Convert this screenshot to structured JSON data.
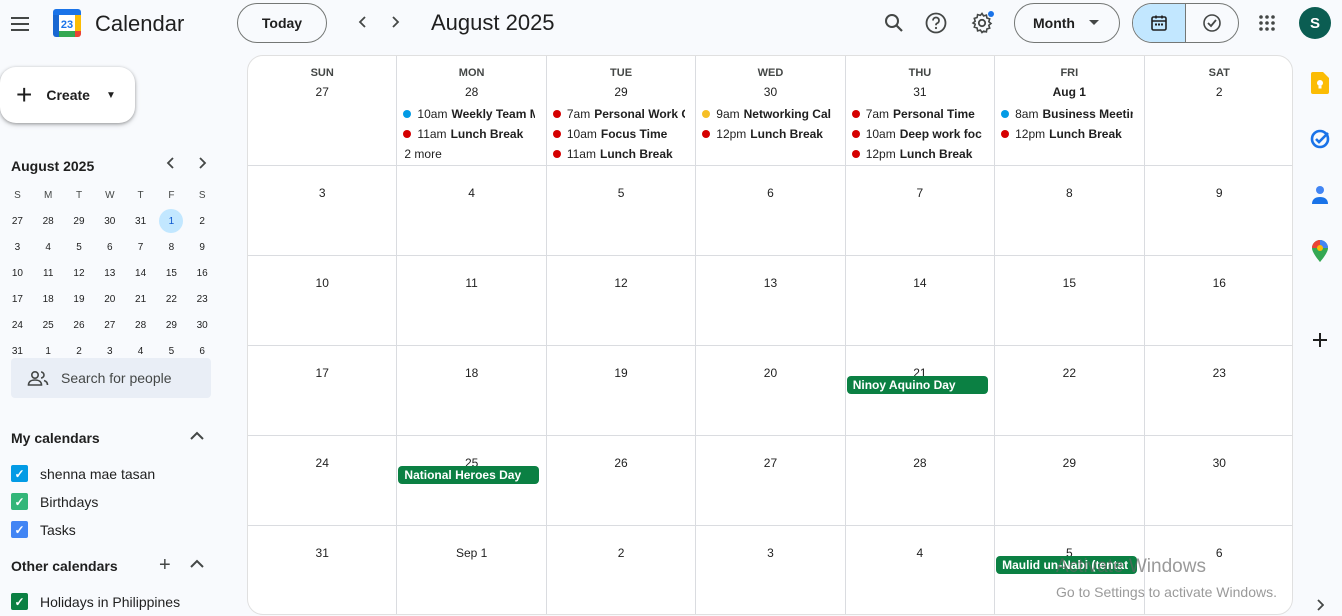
{
  "header": {
    "app_title": "Calendar",
    "logo_day": "23",
    "today_label": "Today",
    "month_title": "August 2025",
    "view_label": "Month",
    "avatar_initial": "S"
  },
  "create": {
    "label": "Create"
  },
  "mini_calendar": {
    "title": "August 2025",
    "weekdays": [
      "S",
      "M",
      "T",
      "W",
      "T",
      "F",
      "S"
    ],
    "weeks": [
      [
        "27",
        "28",
        "29",
        "30",
        "31",
        "1",
        "2"
      ],
      [
        "3",
        "4",
        "5",
        "6",
        "7",
        "8",
        "9"
      ],
      [
        "10",
        "11",
        "12",
        "13",
        "14",
        "15",
        "16"
      ],
      [
        "17",
        "18",
        "19",
        "20",
        "21",
        "22",
        "23"
      ],
      [
        "24",
        "25",
        "26",
        "27",
        "28",
        "29",
        "30"
      ],
      [
        "31",
        "1",
        "2",
        "3",
        "4",
        "5",
        "6"
      ]
    ],
    "selected": "1"
  },
  "search_people": {
    "placeholder": "Search for people"
  },
  "my_calendars": {
    "title": "My calendars",
    "items": [
      {
        "label": "shenna mae tasan",
        "color": "#039be5"
      },
      {
        "label": "Birthdays",
        "color": "#33b679"
      },
      {
        "label": "Tasks",
        "color": "#4285f4"
      }
    ]
  },
  "other_calendars": {
    "title": "Other calendars",
    "items": [
      {
        "label": "Holidays in Philippines",
        "color": "#0b8043"
      }
    ]
  },
  "grid": {
    "weekdays": [
      "SUN",
      "MON",
      "TUE",
      "WED",
      "THU",
      "FRI",
      "SAT"
    ],
    "weeks": [
      {
        "days": [
          "27",
          "28",
          "29",
          "30",
          "31",
          "Aug 1",
          "2"
        ],
        "events": [
          [],
          [
            {
              "time": "10am",
              "title": "Weekly Team M",
              "color": "#039be5"
            },
            {
              "time": "11am",
              "title": "Lunch Break",
              "color": "#d50000"
            }
          ],
          [
            {
              "time": "7am",
              "title": "Personal Work C",
              "color": "#d50000"
            },
            {
              "time": "10am",
              "title": "Focus Time",
              "color": "#d50000"
            },
            {
              "time": "11am",
              "title": "Lunch Break",
              "color": "#d50000"
            }
          ],
          [
            {
              "time": "9am",
              "title": "Networking Cal",
              "color": "#f6bf26"
            },
            {
              "time": "12pm",
              "title": "Lunch Break",
              "color": "#d50000"
            }
          ],
          [
            {
              "time": "7am",
              "title": "Personal Time",
              "color": "#d50000"
            },
            {
              "time": "10am",
              "title": "Deep work foc",
              "color": "#d50000"
            },
            {
              "time": "12pm",
              "title": "Lunch Break",
              "color": "#d50000"
            }
          ],
          [
            {
              "time": "8am",
              "title": "Business Meetin",
              "color": "#039be5"
            },
            {
              "time": "12pm",
              "title": "Lunch Break",
              "color": "#d50000"
            }
          ],
          []
        ],
        "more": [
          "",
          "2 more",
          "",
          "",
          "",
          "",
          ""
        ]
      },
      {
        "days": [
          "3",
          "4",
          "5",
          "6",
          "7",
          "8",
          "9"
        ]
      },
      {
        "days": [
          "10",
          "11",
          "12",
          "13",
          "14",
          "15",
          "16"
        ]
      },
      {
        "days": [
          "17",
          "18",
          "19",
          "20",
          "21",
          "22",
          "23"
        ],
        "allday": [
          [
            "",
            "",
            "",
            "",
            "Ninoy Aquino Day",
            "",
            ""
          ]
        ]
      },
      {
        "days": [
          "24",
          "25",
          "26",
          "27",
          "28",
          "29",
          "30"
        ],
        "allday": [
          [
            "",
            "National Heroes Day",
            "",
            "",
            "",
            "",
            ""
          ]
        ]
      },
      {
        "days": [
          "31",
          "Sep 1",
          "2",
          "3",
          "4",
          "5",
          "6"
        ],
        "allday": [
          [
            "",
            "",
            "",
            "",
            "",
            "Maulid un-Nabi (tentat",
            ""
          ]
        ]
      }
    ]
  },
  "watermark": {
    "line1": "Activate Windows",
    "line2": "Go to Settings to activate Windows."
  },
  "icons": {
    "search": "search-icon",
    "help": "help-icon",
    "settings": "gear-icon",
    "apps": "apps-grid-icon",
    "keep": "keep-icon",
    "tasks": "tasks-icon",
    "contacts": "contacts-icon",
    "maps": "maps-icon",
    "add": "plus-icon"
  }
}
